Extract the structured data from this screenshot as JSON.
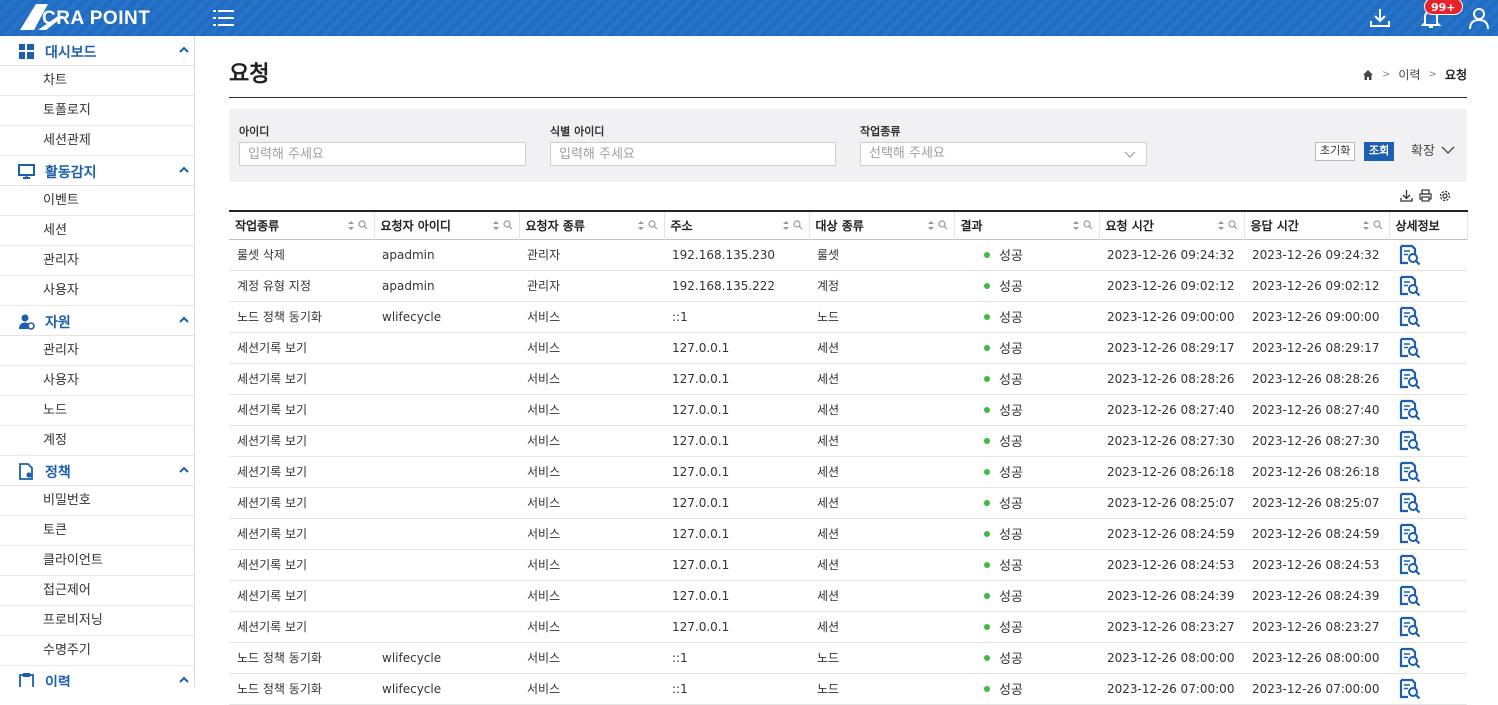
{
  "header": {
    "logo_text": "CRA POINT",
    "notification_count": "99+",
    "icons": [
      "logo-icon",
      "menu-icon",
      "download-icon",
      "bell-icon",
      "user-icon"
    ]
  },
  "sidebar": {
    "groups": [
      {
        "label": "대시보드",
        "icon": "dashboard-icon",
        "items": [
          "차트",
          "토폴로지",
          "세션관제"
        ]
      },
      {
        "label": "활동감지",
        "icon": "monitor-icon",
        "items": [
          "이벤트",
          "세션",
          "관리자",
          "사용자"
        ]
      },
      {
        "label": "자원",
        "icon": "resource-icon",
        "items": [
          "관리자",
          "사용자",
          "노드",
          "계정"
        ]
      },
      {
        "label": "정책",
        "icon": "policy-icon",
        "items": [
          "비밀번호",
          "토큰",
          "클라이언트",
          "접근제어",
          "프로비저닝",
          "수명주기"
        ]
      },
      {
        "label": "이력",
        "icon": "history-icon",
        "items": []
      }
    ]
  },
  "page": {
    "title": "요청",
    "breadcrumb": [
      "이력",
      "요청"
    ]
  },
  "filters": {
    "id_label": "아이디",
    "id_placeholder": "입력해 주세요",
    "ident_label": "식별 아이디",
    "ident_placeholder": "입력해 주세요",
    "worktype_label": "작업종류",
    "worktype_placeholder": "선택해 주세요",
    "reset_label": "초기화",
    "search_label": "조회",
    "expand_label": "확장"
  },
  "table": {
    "columns": [
      "작업종류",
      "요청자 아이디",
      "요청자 종류",
      "주소",
      "대상 종류",
      "결과",
      "요청 시간",
      "응답 시간",
      "상세정보"
    ],
    "rows": [
      [
        "룰셋 삭제",
        "apadmin",
        "관리자",
        "192.168.135.230",
        "룰셋",
        "성공",
        "2023-12-26 09:24:32",
        "2023-12-26 09:24:32"
      ],
      [
        "계정 유형 지정",
        "apadmin",
        "관리자",
        "192.168.135.222",
        "계정",
        "성공",
        "2023-12-26 09:02:12",
        "2023-12-26 09:02:12"
      ],
      [
        "노드 정책 동기화",
        "wlifecycle",
        "서비스",
        "::1",
        "노드",
        "성공",
        "2023-12-26 09:00:00",
        "2023-12-26 09:00:00"
      ],
      [
        "세션기록 보기",
        "",
        "서비스",
        "127.0.0.1",
        "세션",
        "성공",
        "2023-12-26 08:29:17",
        "2023-12-26 08:29:17"
      ],
      [
        "세션기록 보기",
        "",
        "서비스",
        "127.0.0.1",
        "세션",
        "성공",
        "2023-12-26 08:28:26",
        "2023-12-26 08:28:26"
      ],
      [
        "세션기록 보기",
        "",
        "서비스",
        "127.0.0.1",
        "세션",
        "성공",
        "2023-12-26 08:27:40",
        "2023-12-26 08:27:40"
      ],
      [
        "세션기록 보기",
        "",
        "서비스",
        "127.0.0.1",
        "세션",
        "성공",
        "2023-12-26 08:27:30",
        "2023-12-26 08:27:30"
      ],
      [
        "세션기록 보기",
        "",
        "서비스",
        "127.0.0.1",
        "세션",
        "성공",
        "2023-12-26 08:26:18",
        "2023-12-26 08:26:18"
      ],
      [
        "세션기록 보기",
        "",
        "서비스",
        "127.0.0.1",
        "세션",
        "성공",
        "2023-12-26 08:25:07",
        "2023-12-26 08:25:07"
      ],
      [
        "세션기록 보기",
        "",
        "서비스",
        "127.0.0.1",
        "세션",
        "성공",
        "2023-12-26 08:24:59",
        "2023-12-26 08:24:59"
      ],
      [
        "세션기록 보기",
        "",
        "서비스",
        "127.0.0.1",
        "세션",
        "성공",
        "2023-12-26 08:24:53",
        "2023-12-26 08:24:53"
      ],
      [
        "세션기록 보기",
        "",
        "서비스",
        "127.0.0.1",
        "세션",
        "성공",
        "2023-12-26 08:24:39",
        "2023-12-26 08:24:39"
      ],
      [
        "세션기록 보기",
        "",
        "서비스",
        "127.0.0.1",
        "세션",
        "성공",
        "2023-12-26 08:23:27",
        "2023-12-26 08:23:27"
      ],
      [
        "노드 정책 동기화",
        "wlifecycle",
        "서비스",
        "::1",
        "노드",
        "성공",
        "2023-12-26 08:00:00",
        "2023-12-26 08:00:00"
      ],
      [
        "노드 정책 동기화",
        "wlifecycle",
        "서비스",
        "::1",
        "노드",
        "성공",
        "2023-12-26 07:00:00",
        "2023-12-26 07:00:00"
      ]
    ]
  },
  "colors": {
    "header_bg": "#1e6cc3",
    "accent": "#1b5fae",
    "success": "#3dbb3d",
    "badge": "#e8212b"
  }
}
